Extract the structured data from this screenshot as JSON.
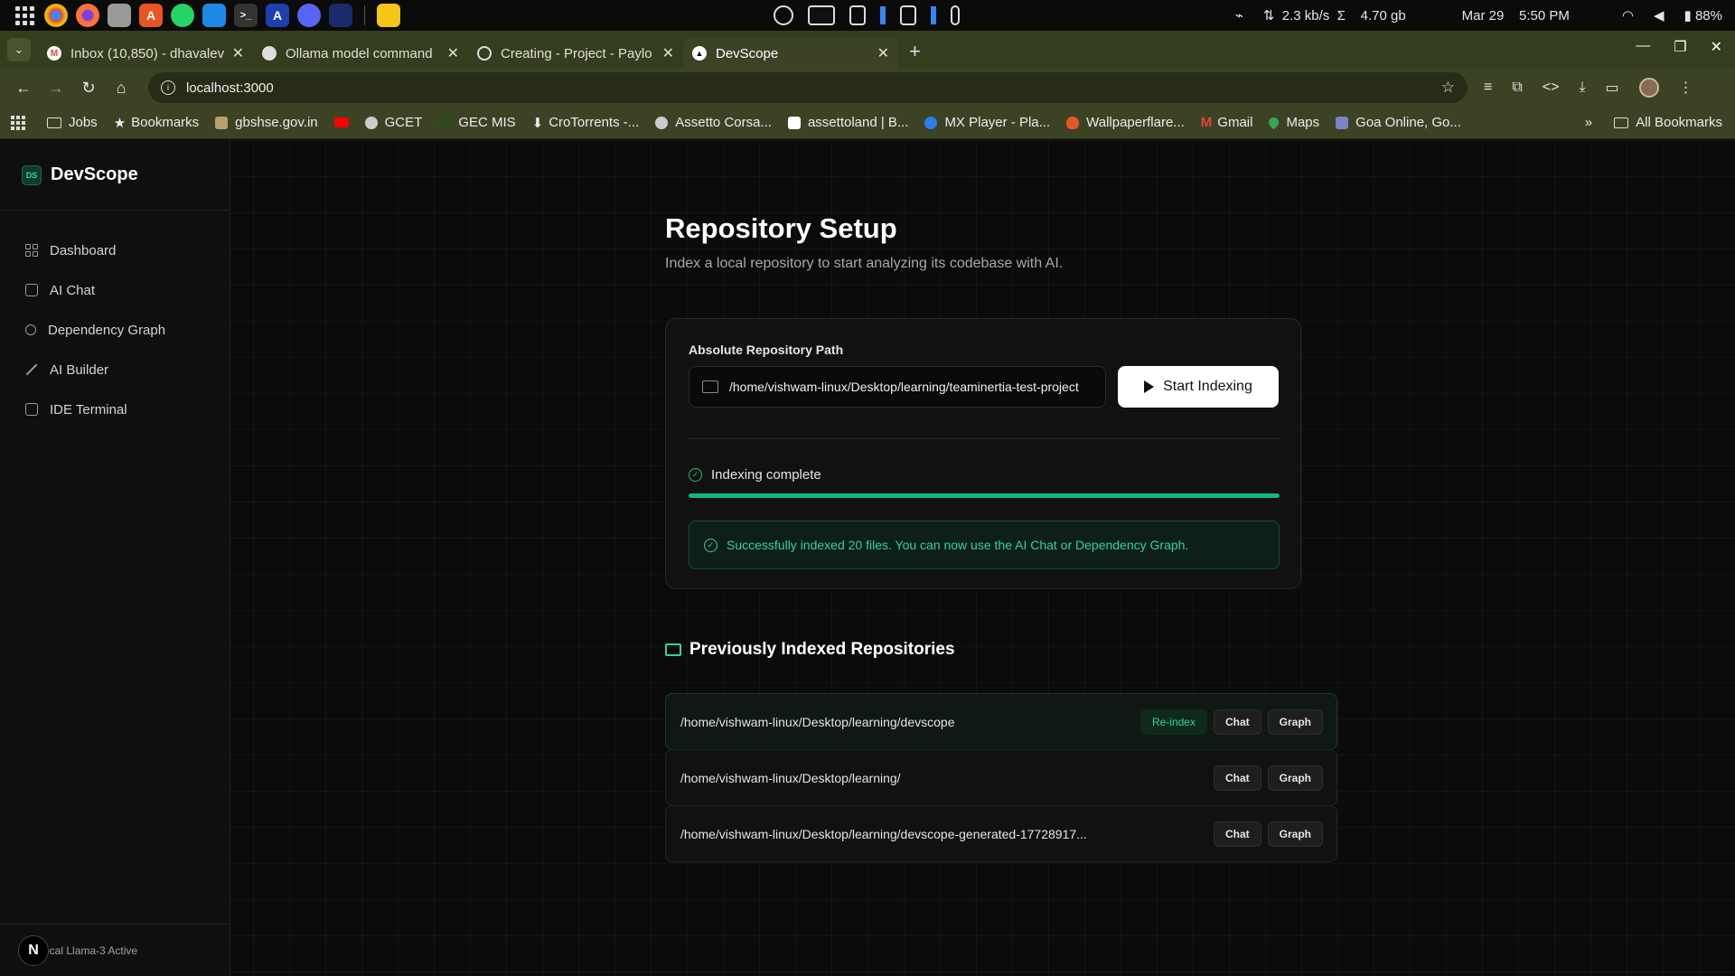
{
  "os": {
    "tray": {
      "network_speed": "2.3 kb/s",
      "sigma": "Σ",
      "data_usage": "4.70 gb",
      "date": "Mar 29",
      "time": "5:50 PM",
      "battery": "88%"
    }
  },
  "browser": {
    "tabs": [
      {
        "label": "Inbox (10,850) - dhavalev",
        "favicon": "gmail-icon",
        "active": false
      },
      {
        "label": "Ollama model command",
        "favicon": "ollama-icon",
        "active": false
      },
      {
        "label": "Creating - Project - Paylo",
        "favicon": "payload-icon",
        "active": false
      },
      {
        "label": "DevScope",
        "favicon": "devscope-icon",
        "active": true
      }
    ],
    "url": "localhost:3000",
    "bookmarks": [
      {
        "label": "Jobs",
        "icon": "folder-icon"
      },
      {
        "label": "Bookmarks",
        "icon": "star-icon"
      },
      {
        "label": "gbshse.gov.in",
        "icon": "gov-icon"
      },
      {
        "label": "",
        "icon": "youtube-icon"
      },
      {
        "label": "GCET",
        "icon": "globe-icon"
      },
      {
        "label": "GEC MIS",
        "icon": "gec-icon"
      },
      {
        "label": "CroTorrents -...",
        "icon": "download-icon"
      },
      {
        "label": "Assetto Corsa...",
        "icon": "globe-icon"
      },
      {
        "label": "assettoland | B...",
        "icon": "wix-icon"
      },
      {
        "label": "MX Player - Pla...",
        "icon": "mx-icon"
      },
      {
        "label": "Wallpaperflare...",
        "icon": "flame-icon"
      },
      {
        "label": "Gmail",
        "icon": "gmail-icon"
      },
      {
        "label": "Maps",
        "icon": "maps-icon"
      },
      {
        "label": "Goa Online, Go...",
        "icon": "php-icon"
      }
    ],
    "all_bookmarks": "All Bookmarks"
  },
  "sidebar": {
    "logo": "DS",
    "brand": "DevScope",
    "items": [
      {
        "label": "Dashboard",
        "icon": "dashboard-icon"
      },
      {
        "label": "AI Chat",
        "icon": "chat-icon"
      },
      {
        "label": "Dependency Graph",
        "icon": "graph-icon"
      },
      {
        "label": "AI Builder",
        "icon": "wand-icon"
      },
      {
        "label": "IDE Terminal",
        "icon": "terminal-icon"
      }
    ],
    "footer_avatar": "N",
    "footer_status": "ocal Llama-3 Active"
  },
  "main": {
    "title": "Repository Setup",
    "subtitle": "Index a local repository to start analyzing its codebase with AI.",
    "path_label": "Absolute Repository Path",
    "path_value": "/home/vishwam-linux/Desktop/learning/teaminertia-test-project",
    "start_button": "Start Indexing",
    "status": "Indexing complete",
    "progress_percent": 100,
    "success_message": "Successfully indexed 20 files. You can now use the AI Chat or Dependency Graph.",
    "previous_title": "Previously Indexed Repositories",
    "repos": [
      {
        "path": "/home/vishwam-linux/Desktop/learning/devscope",
        "reindex": "Re-index",
        "chat": "Chat",
        "graph": "Graph"
      },
      {
        "path": "/home/vishwam-linux/Desktop/learning/",
        "chat": "Chat",
        "graph": "Graph"
      },
      {
        "path": "/home/vishwam-linux/Desktop/learning/devscope-generated-17728917...",
        "chat": "Chat",
        "graph": "Graph"
      }
    ]
  },
  "colors": {
    "accent": "#10b981",
    "accent_text": "#34d399",
    "browser_frame": "#3c4325"
  }
}
